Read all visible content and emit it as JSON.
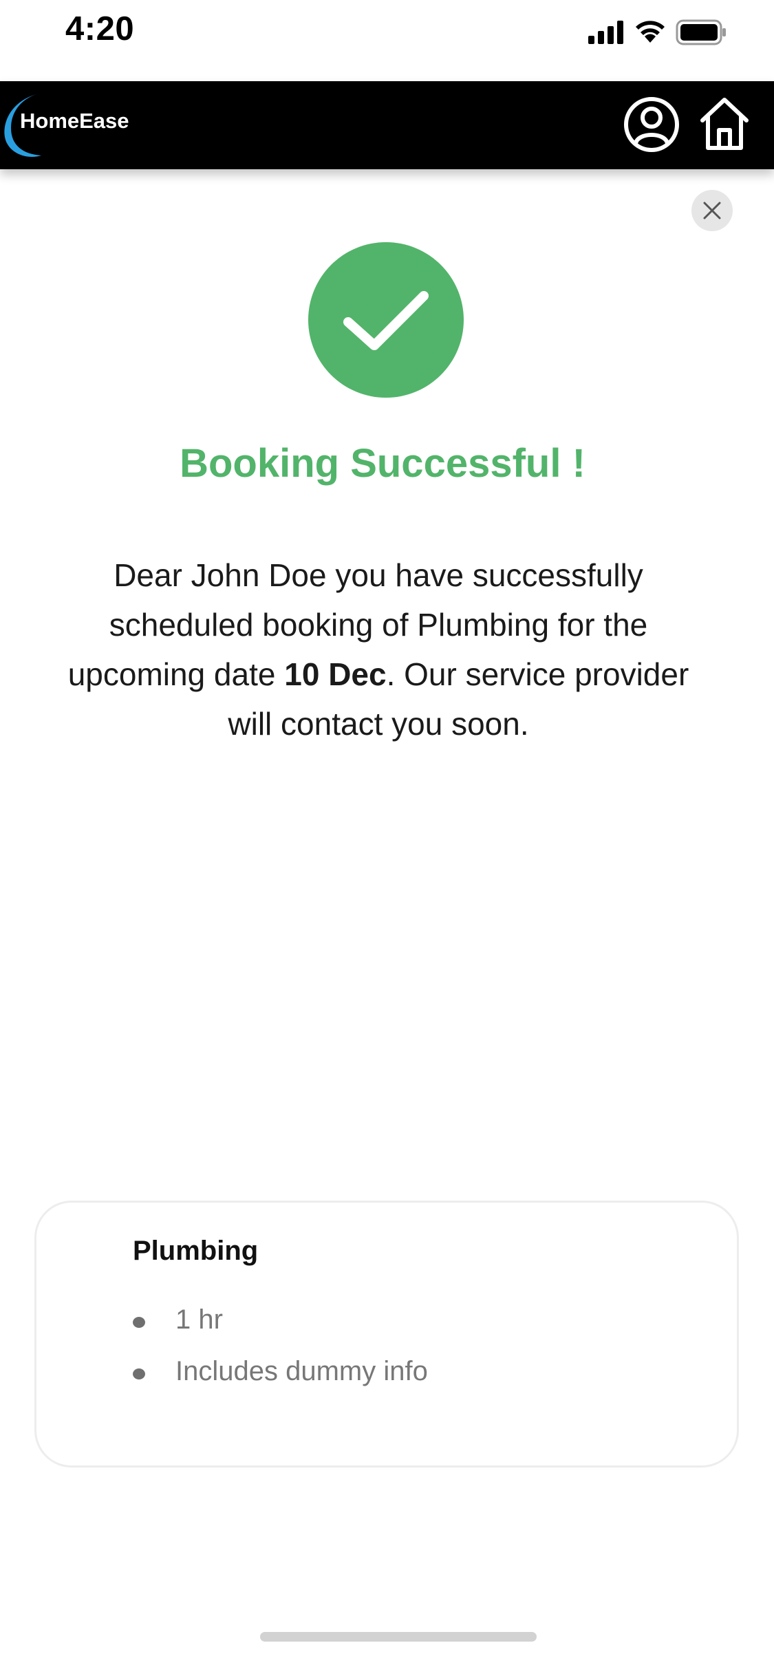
{
  "status_bar": {
    "time": "4:20",
    "icons": [
      "signal-icon",
      "wifi-icon",
      "battery-icon"
    ]
  },
  "header": {
    "logo_text": "HomeEase",
    "icons": [
      "profile-icon",
      "home-icon"
    ]
  },
  "success": {
    "title": "Booking Successful !",
    "message_part1": "Dear John Doe you have successfully scheduled booking of Plumbing for the upcoming date ",
    "date": "10 Dec",
    "message_part2": ". Our service provider will contact you soon."
  },
  "service_card": {
    "title": "Plumbing",
    "items": [
      {
        "label": "1 hr"
      },
      {
        "label": "Includes dummy info"
      }
    ]
  },
  "colors": {
    "success_green": "#52b46a",
    "header_black": "#000000",
    "logo_blue": "#2a9fe0"
  }
}
